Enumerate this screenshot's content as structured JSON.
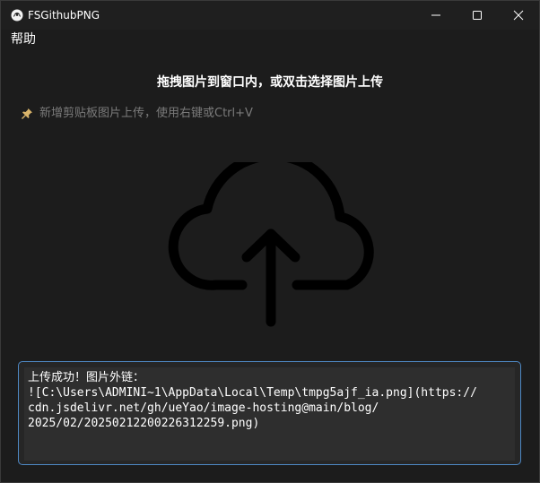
{
  "window": {
    "title": "FSGithubPNG",
    "controls": {
      "minimize_icon": "minimize-icon",
      "maximize_icon": "maximize-icon",
      "close_icon": "close-icon"
    }
  },
  "menu": {
    "help_label": "帮助"
  },
  "main": {
    "heading": "拖拽图片到窗口内，或双击选择图片上传",
    "tip": {
      "icon": "pin-icon",
      "text": "新增剪贴板图片上传，使用右键或Ctrl+V"
    },
    "upload_icon": "cloud-upload-icon",
    "result": {
      "lines": [
        "上传成功！图片外链：",
        "![C:\\Users\\ADMINI~1\\AppData\\Local\\Temp\\tmpg5ajf_ia.png](https://",
        "cdn.jsdelivr.net/gh/ueYao/image-hosting@main/blog/",
        "2025/02/20250212200226312259.png)"
      ]
    }
  },
  "colors": {
    "background": "#1c1c1c",
    "text_primary": "#ffffff",
    "text_muted": "#7b7b7b",
    "focus_border": "#4e88c4",
    "icon_stroke": "#000000"
  }
}
